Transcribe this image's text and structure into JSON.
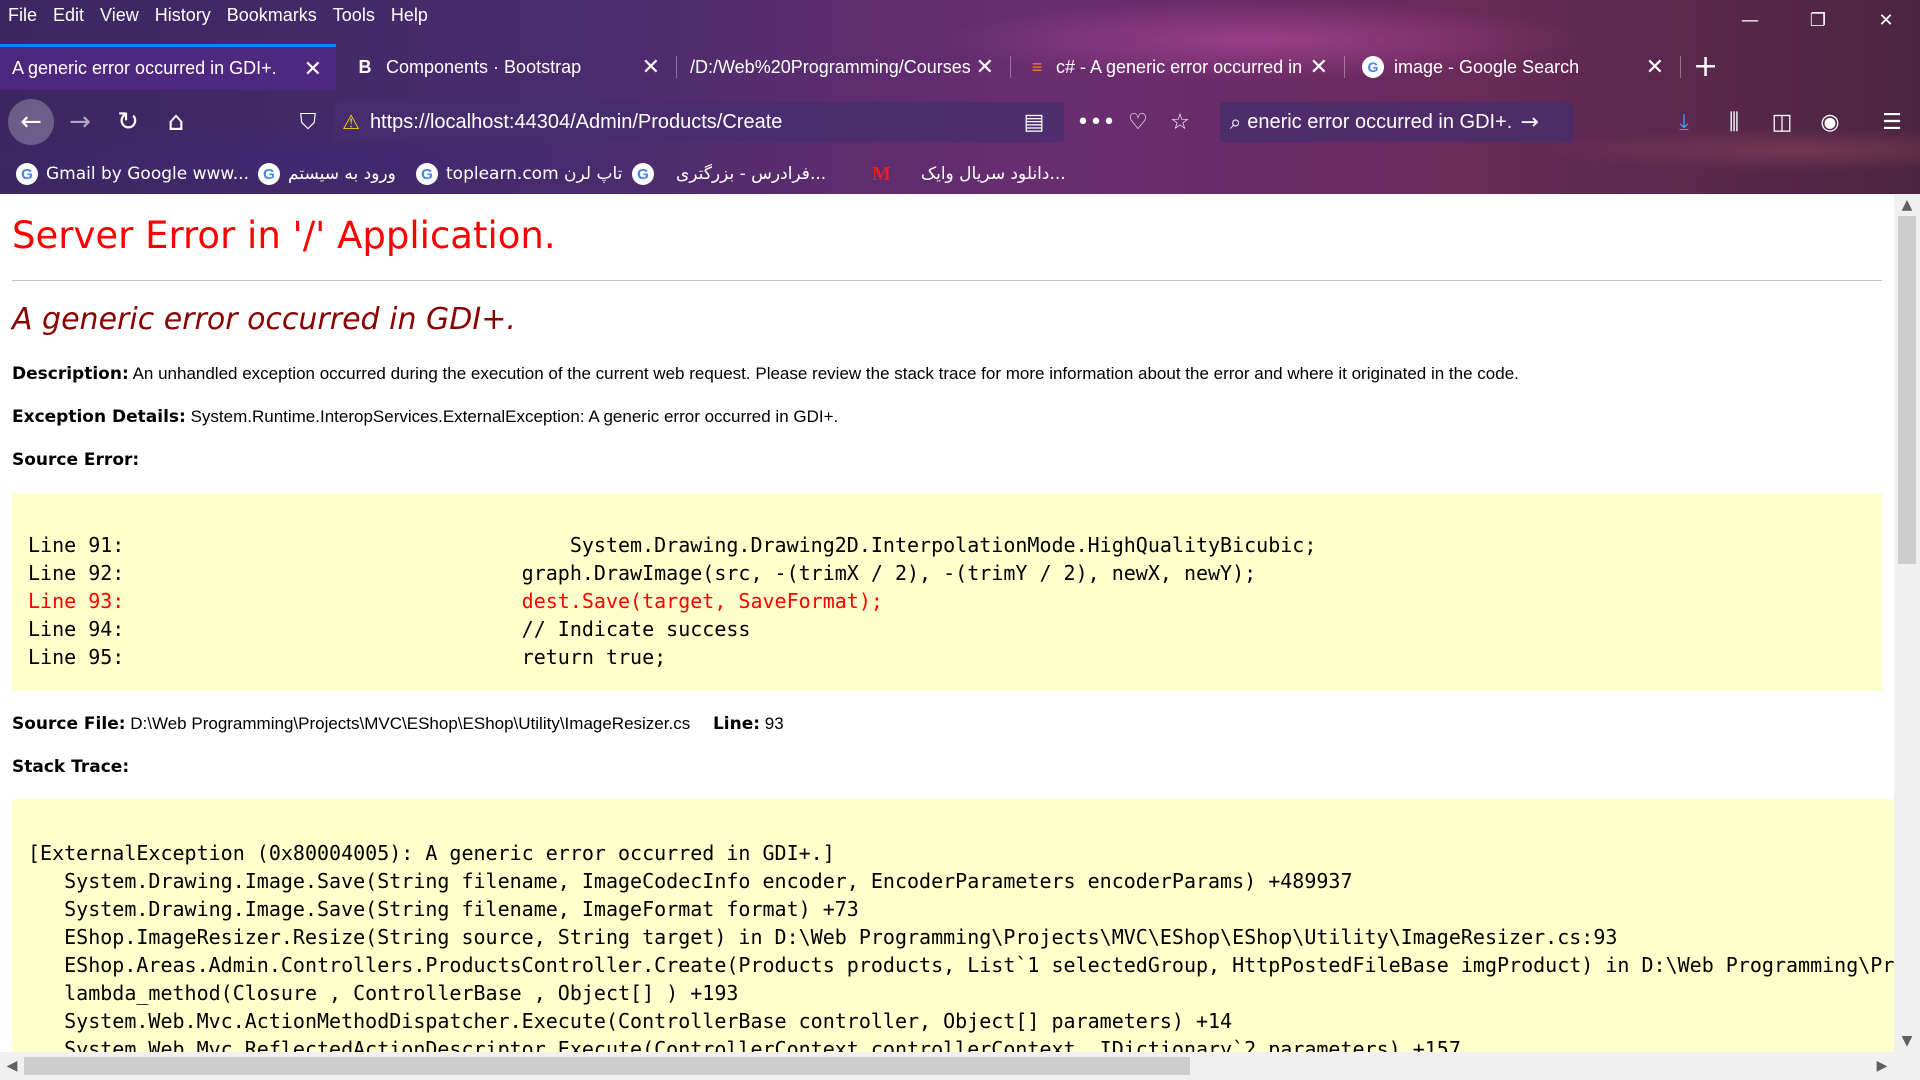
{
  "menu": [
    "File",
    "Edit",
    "View",
    "History",
    "Bookmarks",
    "Tools",
    "Help"
  ],
  "window_controls": {
    "minimize": "—",
    "restore": "❐",
    "close": "✕"
  },
  "tabs": [
    {
      "title": "A generic error occurred in GDI+.",
      "icon": "none",
      "active": true
    },
    {
      "title": "Components · Bootstrap",
      "icon": "bootstrap-icon",
      "active": false
    },
    {
      "title": "/D:/Web%20Programming/Courses",
      "icon": "none",
      "active": false
    },
    {
      "title": "c# - A generic error occurred in",
      "icon": "stackoverflow-icon",
      "active": false
    },
    {
      "title": "image - Google Search",
      "icon": "google-icon",
      "active": false
    }
  ],
  "tab_close_glyph": "✕",
  "new_tab_glyph": "+",
  "url": "https://localhost:44304/Admin/Products/Create",
  "search_text": "eneric error occurred in GDI+.",
  "bookmarks": [
    {
      "label": "Gmail by Google www...",
      "icon": "google-icon"
    },
    {
      "label": "ورود به سیستم",
      "icon": "google-icon"
    },
    {
      "label": "toplearn.com تاپ لرن",
      "icon": "google-icon"
    },
    {
      "label": "فرادرس - بزرگتری...",
      "icon": "google-icon"
    },
    {
      "label": "دانلود سریال وایک...",
      "icon": "m-logo-icon"
    }
  ],
  "page": {
    "title": "Server Error in '/' Application.",
    "error_heading": "A generic error occurred in GDI+.",
    "description_label": "Description:",
    "description_text": "An unhandled exception occurred during the execution of the current web request. Please review the stack trace for more information about the error and where it originated in the code.",
    "exception_label": "Exception Details:",
    "exception_text": "System.Runtime.InteropServices.ExternalException: A generic error occurred in GDI+.",
    "source_error_label": "Source Error:",
    "source_lines": [
      {
        "text": "Line 91:                                     System.Drawing.Drawing2D.InterpolationMode.HighQualityBicubic;",
        "error": false
      },
      {
        "text": "Line 92:                                 graph.DrawImage(src, -(trimX / 2), -(trimY / 2), newX, newY);",
        "error": false
      },
      {
        "text": "Line 93:                                 dest.Save(target, SaveFormat);",
        "error": true
      },
      {
        "text": "Line 94:                                 // Indicate success",
        "error": false
      },
      {
        "text": "Line 95:                                 return true;",
        "error": false
      }
    ],
    "source_file_label": "Source File:",
    "source_file_text": "D:\\Web Programming\\Projects\\MVC\\EShop\\EShop\\Utility\\ImageResizer.cs",
    "line_label": "Line:",
    "line_value": "93",
    "stack_trace_label": "Stack Trace:",
    "stack_lines": [
      "[ExternalException (0x80004005): A generic error occurred in GDI+.]",
      "   System.Drawing.Image.Save(String filename, ImageCodecInfo encoder, EncoderParameters encoderParams) +489937",
      "   System.Drawing.Image.Save(String filename, ImageFormat format) +73",
      "   EShop.ImageResizer.Resize(String source, String target) in D:\\Web Programming\\Projects\\MVC\\EShop\\EShop\\Utility\\ImageResizer.cs:93",
      "   EShop.Areas.Admin.Controllers.ProductsController.Create(Products products, List`1 selectedGroup, HttpPostedFileBase imgProduct) in D:\\Web Programming\\Pr",
      "   lambda_method(Closure , ControllerBase , Object[] ) +193",
      "   System.Web.Mvc.ActionMethodDispatcher.Execute(ControllerBase controller, Object[] parameters) +14",
      "   System.Web.Mvc.ReflectedActionDescriptor.Execute(ControllerContext controllerContext, IDictionary`2 parameters) +157"
    ]
  },
  "colors": {
    "title_red": "#ff0000",
    "heading_darkred": "#8b0000",
    "code_bg": "#ffffcc",
    "active_tab_accent": "#0a84ff"
  }
}
